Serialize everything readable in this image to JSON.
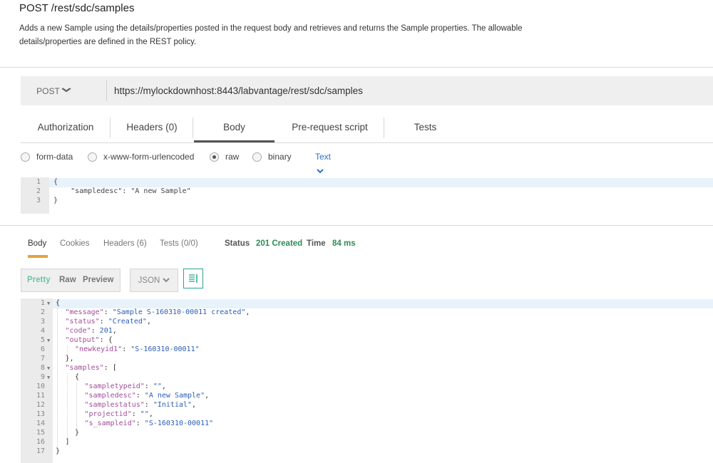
{
  "header": {
    "title": "POST /rest/sdc/samples",
    "description_line1": "Adds a new Sample using the details/properties posted in the request body and retrieves and returns the Sample properties. The allowable",
    "description_line2": "details/properties are defined in the REST policy."
  },
  "request": {
    "method": "POST",
    "url": "https://mylockdownhost:8443/labvantage/rest/sdc/samples",
    "tabs": [
      {
        "label": "Authorization"
      },
      {
        "label": "Headers (0)"
      },
      {
        "label": "Body"
      },
      {
        "label": "Pre-request script"
      },
      {
        "label": "Tests"
      }
    ],
    "active_tab": "Body",
    "body_modes": [
      {
        "label": "form-data",
        "selected": false
      },
      {
        "label": "x-www-form-urlencoded",
        "selected": false
      },
      {
        "label": "raw",
        "selected": true
      },
      {
        "label": "binary",
        "selected": false
      }
    ],
    "content_type": "Text",
    "body_lines": [
      "{",
      "    \"sampledesc\": \"A new Sample\"",
      "}"
    ],
    "body_line_numbers": [
      "1",
      "2",
      "3"
    ]
  },
  "response": {
    "tabs": [
      {
        "label": "Body"
      },
      {
        "label": "Cookies"
      },
      {
        "label": "Headers (6)"
      },
      {
        "label": "Tests (0/0)"
      }
    ],
    "active_tab": "Body",
    "status_label": "Status",
    "status_value": "201 Created",
    "time_label": "Time",
    "time_value": "84 ms",
    "view_modes": [
      {
        "label": "Pretty"
      },
      {
        "label": "Raw"
      },
      {
        "label": "Preview"
      }
    ],
    "active_view": "Pretty",
    "format": "JSON",
    "line_numbers": [
      "1",
      "2",
      "3",
      "4",
      "5",
      "6",
      "7",
      "8",
      "9",
      "10",
      "11",
      "12",
      "13",
      "14",
      "15",
      "16",
      "17"
    ],
    "folded_lines": [
      "1",
      "5",
      "8",
      "9"
    ],
    "lines": [
      {
        "text": "{"
      },
      {
        "key": "\"message\"",
        "value": "\"Sample S-160310-00011 created\"",
        "trail": ","
      },
      {
        "key": "\"status\"",
        "value": "\"Created\"",
        "trail": ","
      },
      {
        "key": "\"code\"",
        "value": "201",
        "trail": ","
      },
      {
        "key": "\"output\"",
        "value": "",
        "trail": "{"
      },
      {
        "key": "\"newkeyid1\"",
        "value": "\"S-160310-00011\"",
        "trail": ""
      },
      {
        "text": "},"
      },
      {
        "key": "\"samples\"",
        "value": "",
        "trail": "["
      },
      {
        "text": "{"
      },
      {
        "key": "\"sampletypeid\"",
        "value": "\"\"",
        "trail": ","
      },
      {
        "key": "\"sampledesc\"",
        "value": "\"A new Sample\"",
        "trail": ","
      },
      {
        "key": "\"samplestatus\"",
        "value": "\"Initial\"",
        "trail": ","
      },
      {
        "key": "\"projectid\"",
        "value": "\"\"",
        "trail": ","
      },
      {
        "key": "\"s_sampleid\"",
        "value": "\"S-160310-00011\"",
        "trail": ""
      },
      {
        "text": "}"
      },
      {
        "text": "]"
      },
      {
        "text": "}"
      }
    ]
  },
  "colors": {
    "active_tab_underline": "#555555",
    "response_tab_underline": "#e6a23c",
    "status_green": "#2e8b57",
    "link_blue": "#2a75c9",
    "json_key": "#a24d9a",
    "json_string": "#2b5db5"
  },
  "icons": {
    "method_dropdown": "chevron-down-icon",
    "content_type_dropdown": "chevron-down-icon",
    "format_dropdown": "chevron-down-icon",
    "wrap_button": "wrap-lines-icon"
  }
}
